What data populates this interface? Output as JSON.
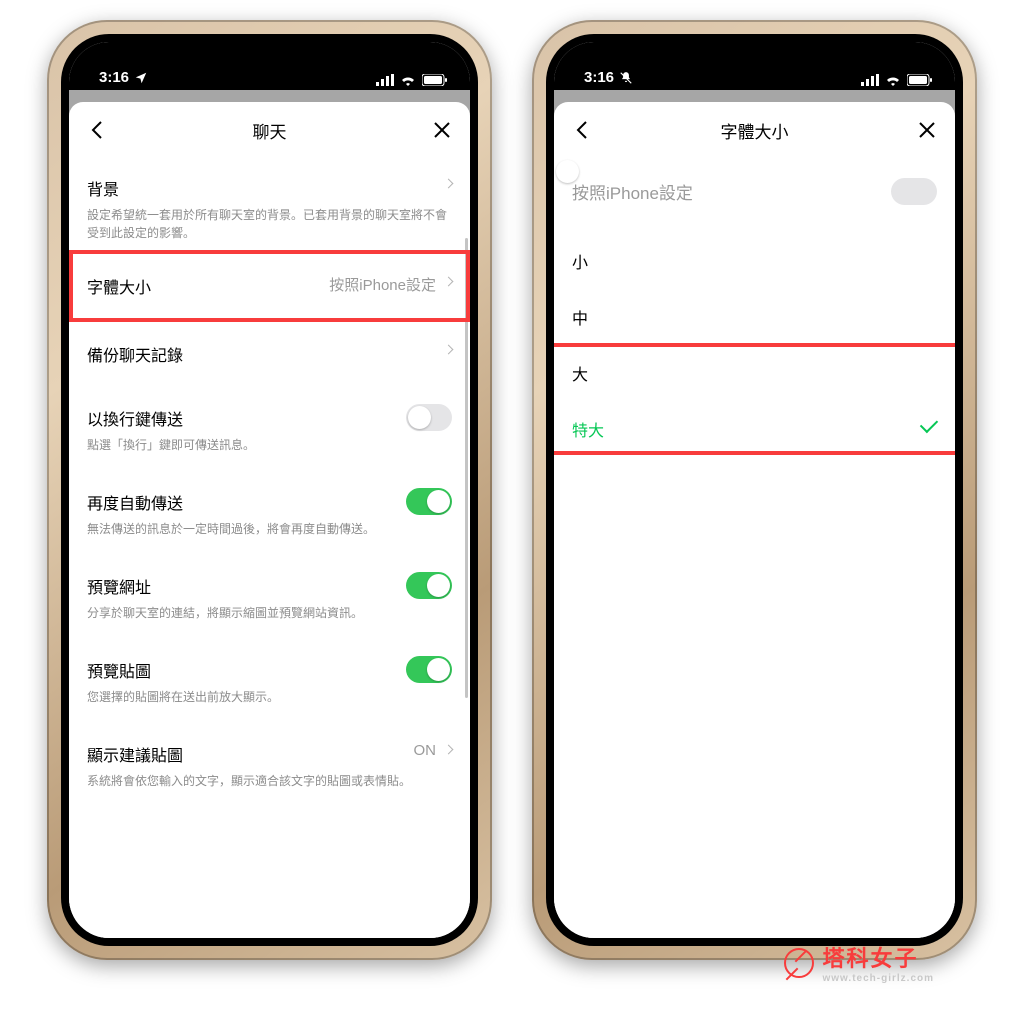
{
  "status": {
    "time": "3:16",
    "left_icon_a": "location-icon",
    "left_icon_b": "silent-icon"
  },
  "left_screen": {
    "title": "聊天",
    "rows": {
      "background": {
        "title": "背景",
        "sub": "設定希望統一套用於所有聊天室的背景。已套用背景的聊天室將不會受到此設定的影響。"
      },
      "font_size": {
        "title": "字體大小",
        "value": "按照iPhone設定"
      },
      "backup": {
        "title": "備份聊天記錄"
      },
      "send_enter": {
        "title": "以換行鍵傳送",
        "sub": "點選「換行」鍵即可傳送訊息。"
      },
      "resend": {
        "title": "再度自動傳送",
        "sub": "無法傳送的訊息於一定時間過後，將會再度自動傳送。"
      },
      "preview_url": {
        "title": "預覽網址",
        "sub": "分享於聊天室的連結，將顯示縮圖並預覽網站資訊。"
      },
      "preview_sticker": {
        "title": "預覽貼圖",
        "sub": "您選擇的貼圖將在送出前放大顯示。"
      },
      "suggest_sticker": {
        "title": "顯示建議貼圖",
        "value": "ON",
        "sub": "系統將會依您輸入的文字，顯示適合該文字的貼圖或表情貼。"
      }
    }
  },
  "right_screen": {
    "title": "字體大小",
    "follow_iphone": "按照iPhone設定",
    "options": {
      "small": "小",
      "medium": "中",
      "large": "大",
      "xlarge": "特大"
    }
  },
  "watermark": {
    "main": "塔科女子",
    "sub": "www.tech-girlz.com"
  }
}
